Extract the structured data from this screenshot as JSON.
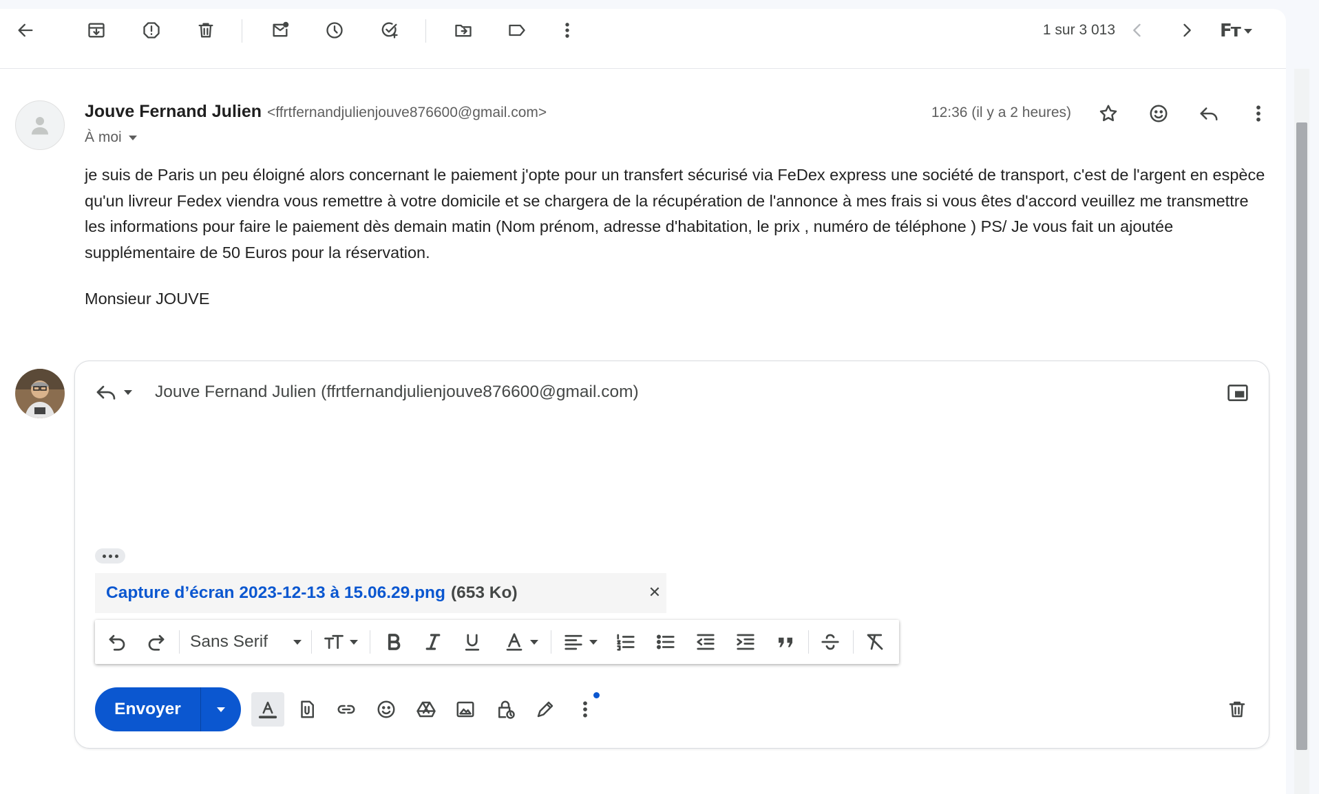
{
  "toolbar": {
    "pager": "1 sur 3 013",
    "icons": [
      "back-arrow-icon",
      "archive-icon",
      "report-spam-icon",
      "delete-icon",
      "mark-unread-icon",
      "snooze-icon",
      "add-task-icon",
      "move-to-icon",
      "label-icon",
      "more-vertical-icon",
      "newer-chevron-icon",
      "older-chevron-icon",
      "input-tools-icon"
    ]
  },
  "message": {
    "sender_name": "Jouve Fernand Julien",
    "sender_email": "<ffrtfernandjulienjouve876600@gmail.com>",
    "to": "À moi",
    "time": "12:36 (il y a 2 heures)",
    "body": "je suis de Paris un peu éloigné alors concernant le paiement j'opte pour un transfert sécurisé via FeDex express une société de transport, c'est de l'argent en espèce qu'un livreur Fedex viendra vous remettre à votre domicile et se chargera de la récupération de l'annonce à mes frais si vous êtes d'accord veuillez me transmettre les informations pour faire le paiement dès demain matin (Nom prénom, adresse d'habitation, le prix  , numéro de téléphone ) PS/ Je vous fait un ajoutée supplémentaire de 50 Euros pour la réservation.",
    "signature": "Monsieur JOUVE"
  },
  "compose": {
    "recipient": "Jouve Fernand Julien (ffrtfernandjulienjouve876600@gmail.com)",
    "attachment": {
      "name": "Capture d’écran 2023-12-13 à 15.06.29.png",
      "size": "(653 Ko)"
    },
    "formatting": {
      "font": "Sans Serif"
    },
    "send_label": "Envoyer"
  },
  "colors": {
    "accent": "#0b57d0",
    "icon": "#444746",
    "text": "#1f1f1f"
  }
}
